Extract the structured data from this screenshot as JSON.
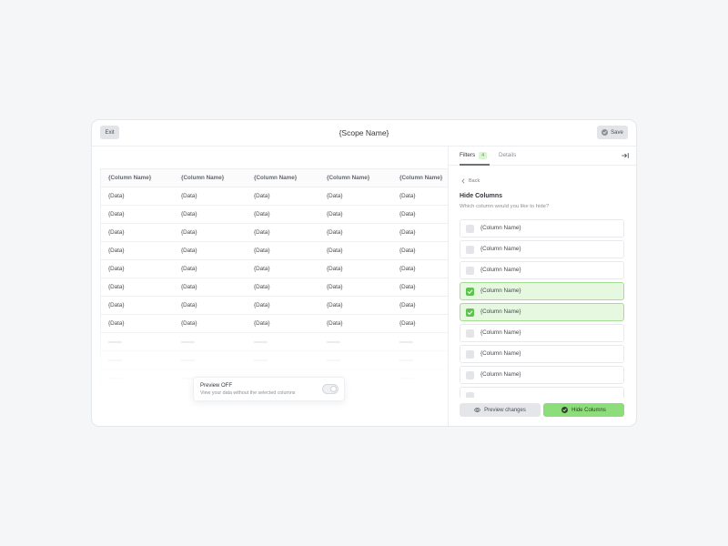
{
  "window": {
    "exit_label": "Exit",
    "title": "{Scope Name}",
    "save_label": "Save",
    "save_icon": "check-circle-icon"
  },
  "table": {
    "columns": [
      "{Column Name}",
      "{Column Name}",
      "{Column Name}",
      "{Column Name}",
      "{Column Name}"
    ],
    "rows": [
      [
        "{Data}",
        "{Data}",
        "{Data}",
        "{Data}",
        "{Data}"
      ],
      [
        "{Data}",
        "{Data}",
        "{Data}",
        "{Data}",
        "{Data}"
      ],
      [
        "{Data}",
        "{Data}",
        "{Data}",
        "{Data}",
        "{Data}"
      ],
      [
        "{Data}",
        "{Data}",
        "{Data}",
        "{Data}",
        "{Data}"
      ],
      [
        "{Data}",
        "{Data}",
        "{Data}",
        "{Data}",
        "{Data}"
      ],
      [
        "{Data}",
        "{Data}",
        "{Data}",
        "{Data}",
        "{Data}"
      ],
      [
        "{Data}",
        "{Data}",
        "{Data}",
        "{Data}",
        "{Data}"
      ],
      [
        "{Data}",
        "{Data}",
        "{Data}",
        "{Data}",
        "{Data}"
      ]
    ]
  },
  "preview_toast": {
    "title": "Preview OFF",
    "description": "View your data without the selected columns",
    "enabled": false
  },
  "side_panel": {
    "tabs": [
      {
        "label": "Filters",
        "badge": "4",
        "active": true
      },
      {
        "label": "Details",
        "active": false
      }
    ],
    "collapse_icon": "collapse-right-icon",
    "back_label": "Back",
    "back_icon": "chevron-left-icon",
    "heading": "Hide Columns",
    "prompt": "Which column would you like to hide?",
    "columns": [
      {
        "label": "{Column Name}",
        "checked": false
      },
      {
        "label": "{Column Name}",
        "checked": false
      },
      {
        "label": "{Column Name}",
        "checked": false
      },
      {
        "label": "{Column Name}",
        "checked": true
      },
      {
        "label": "{Column Name}",
        "checked": true
      },
      {
        "label": "{Column Name}",
        "checked": false
      },
      {
        "label": "{Column Name}",
        "checked": false
      },
      {
        "label": "{Column Name}",
        "checked": false
      },
      {
        "label": "",
        "checked": false
      }
    ],
    "actions": {
      "preview_label": "Preview changes",
      "preview_icon": "eye-icon",
      "hide_label": "Hide Columns",
      "hide_icon": "check-circle-icon"
    }
  },
  "colors": {
    "page_background": "#f5f6f8",
    "accent_green": "#8edd7b",
    "checked_row_background": "#e6f8df",
    "checked_row_border": "#a3de94",
    "checkbox_checked": "#5cc44c",
    "badge_background": "#dcf4d4",
    "badge_text": "#4aa83a",
    "neutral_button": "#e4e6ea"
  }
}
